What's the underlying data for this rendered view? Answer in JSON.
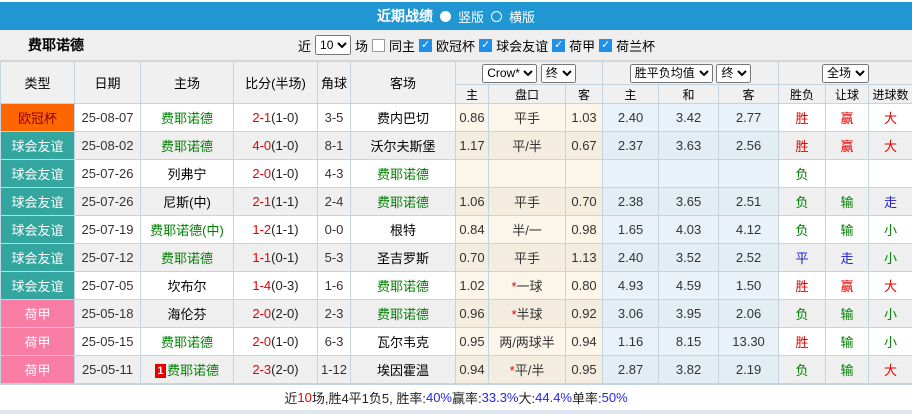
{
  "colors": {
    "bar-blue": "#2097d3",
    "ucl-orange": "#ff6600",
    "ucl-text": "#8b0000",
    "friendly-teal": "#33a6a0",
    "eredivisie-pink": "#f87ca3",
    "red": "#e60000",
    "green": "#008000",
    "blue": "#2121cc",
    "pct-blue": "#2525e6",
    "crown-bg": "#fbf5ea",
    "avg-bg": "#e9f2f9",
    "border": "#c3d5e3",
    "header-bg": "#f0f0f0"
  },
  "titlebar": {
    "title": "近期战绩",
    "radios": [
      {
        "label": "竖版",
        "selected": true
      },
      {
        "label": "横版",
        "selected": false
      }
    ]
  },
  "filterbar": {
    "team": "费耶诺德",
    "near_label": "近",
    "count_value": "10",
    "count_suffix": "场",
    "checkboxes": [
      {
        "label": "同主",
        "checked": false
      },
      {
        "label": "欧冠杯",
        "checked": true
      },
      {
        "label": "球会友谊",
        "checked": true
      },
      {
        "label": "荷甲",
        "checked": true
      },
      {
        "label": "荷兰杯",
        "checked": true
      }
    ]
  },
  "table": {
    "selects": {
      "crown": "Crow*",
      "crown_final": "终",
      "avg": "胜平负均值",
      "avg_final": "终",
      "full": "全场"
    },
    "headers": {
      "league": "类型",
      "date": "日期",
      "home": "主场",
      "score": "比分(半场)",
      "corner": "角球",
      "away": "客场",
      "h": "主",
      "handicap": "盘口",
      "a": "客",
      "avg_h": "主",
      "avg_d": "和",
      "avg_a": "客",
      "wdl": "胜负",
      "asian": "让球",
      "goals": "进球数"
    },
    "rows": [
      {
        "league": "欧冠杯",
        "date": "25-08-07",
        "home": "费耶诺德",
        "score": "2-1",
        "half": "(1-0)",
        "corner": "3-5",
        "away": "费内巴切",
        "h_odds": "0.86",
        "handicap": "平手",
        "a_odds": "1.03",
        "avg_h": "2.40",
        "avg_d": "3.42",
        "avg_a": "2.77",
        "wdl": "胜",
        "asian": "赢",
        "goals": "大"
      },
      {
        "league": "球会友谊",
        "date": "25-08-02",
        "home": "费耶诺德",
        "score": "4-0",
        "half": "(1-0)",
        "corner": "8-1",
        "away": "沃尔夫斯堡",
        "h_odds": "1.17",
        "handicap": "平/半",
        "a_odds": "0.67",
        "avg_h": "2.37",
        "avg_d": "3.63",
        "avg_a": "2.56",
        "wdl": "胜",
        "asian": "赢",
        "goals": "大"
      },
      {
        "league": "球会友谊",
        "date": "25-07-26",
        "home": "列弗宁",
        "score": "2-0",
        "half": "(1-0)",
        "corner": "4-3",
        "away": "费耶诺德",
        "wdl": "负"
      },
      {
        "league": "球会友谊",
        "date": "25-07-26",
        "home": "尼斯(中)",
        "score": "2-1",
        "half": "(1-1)",
        "corner": "2-4",
        "away": "费耶诺德",
        "h_odds": "1.06",
        "handicap": "平手",
        "a_odds": "0.70",
        "avg_h": "2.38",
        "avg_d": "3.65",
        "avg_a": "2.51",
        "wdl": "负",
        "asian": "输",
        "goals": "走"
      },
      {
        "league": "球会友谊",
        "date": "25-07-19",
        "home": "费耶诺德(中)",
        "score": "1-2",
        "half": "(1-1)",
        "corner": "0-0",
        "away": "根特",
        "h_odds": "0.84",
        "handicap": "半/一",
        "a_odds": "0.98",
        "avg_h": "1.65",
        "avg_d": "4.03",
        "avg_a": "4.12",
        "wdl": "负",
        "asian": "输",
        "goals": "小"
      },
      {
        "league": "球会友谊",
        "date": "25-07-12",
        "home": "费耶诺德",
        "score": "1-1",
        "half": "(0-1)",
        "corner": "5-3",
        "away": "圣吉罗斯",
        "h_odds": "0.70",
        "handicap": "平手",
        "a_odds": "1.13",
        "avg_h": "2.40",
        "avg_d": "3.52",
        "avg_a": "2.52",
        "wdl": "平",
        "asian": "走",
        "goals": "小"
      },
      {
        "league": "球会友谊",
        "date": "25-07-05",
        "home": "坎布尔",
        "score": "1-4",
        "half": "(0-3)",
        "corner": "1-6",
        "away": "费耶诺德",
        "h_odds": "1.02",
        "handicap_star": "*",
        "handicap": "一球",
        "a_odds": "0.80",
        "avg_h": "4.93",
        "avg_d": "4.59",
        "avg_a": "1.50",
        "wdl": "胜",
        "asian": "赢",
        "goals": "大"
      },
      {
        "league": "荷甲",
        "date": "25-05-18",
        "home": "海伦芬",
        "score": "2-0",
        "half": "(2-0)",
        "corner": "2-3",
        "away": "费耶诺德",
        "h_odds": "0.96",
        "handicap_star": "*",
        "handicap": "半球",
        "a_odds": "0.92",
        "avg_h": "3.06",
        "avg_d": "3.95",
        "avg_a": "2.06",
        "wdl": "负",
        "asian": "输",
        "goals": "小"
      },
      {
        "league": "荷甲",
        "date": "25-05-15",
        "home": "费耶诺德",
        "score": "2-0",
        "half": "(1-0)",
        "corner": "6-3",
        "away": "瓦尔韦克",
        "h_odds": "0.95",
        "handicap": "两/两球半",
        "a_odds": "0.94",
        "avg_h": "1.16",
        "avg_d": "8.15",
        "avg_a": "13.30",
        "wdl": "胜",
        "asian": "输",
        "goals": "小"
      },
      {
        "league": "荷甲",
        "date": "25-05-11",
        "home": "费耶诺德",
        "home_badge": "1",
        "score": "2-3",
        "half": "(2-0)",
        "corner": "1-12",
        "away": "埃因霍温",
        "h_odds": "0.94",
        "handicap_star": "*",
        "handicap": "平/半",
        "a_odds": "0.95",
        "avg_h": "2.87",
        "avg_d": "3.82",
        "avg_a": "2.19",
        "wdl": "负",
        "asian": "输",
        "goals": "大"
      }
    ]
  },
  "footer": {
    "segments": [
      {
        "text": "近",
        "color": "black"
      },
      {
        "text": "10",
        "color": "red"
      },
      {
        "text": "场,胜4平1负5, 胜率:",
        "color": "black"
      },
      {
        "text": "40%",
        "color": "blue"
      },
      {
        "text": " 赢率:",
        "color": "black"
      },
      {
        "text": "33.3%",
        "color": "blue"
      },
      {
        "text": " 大:",
        "color": "black"
      },
      {
        "text": "44.4%",
        "color": "blue"
      },
      {
        "text": " 单率:",
        "color": "black"
      },
      {
        "text": "50%",
        "color": "blue"
      }
    ]
  }
}
